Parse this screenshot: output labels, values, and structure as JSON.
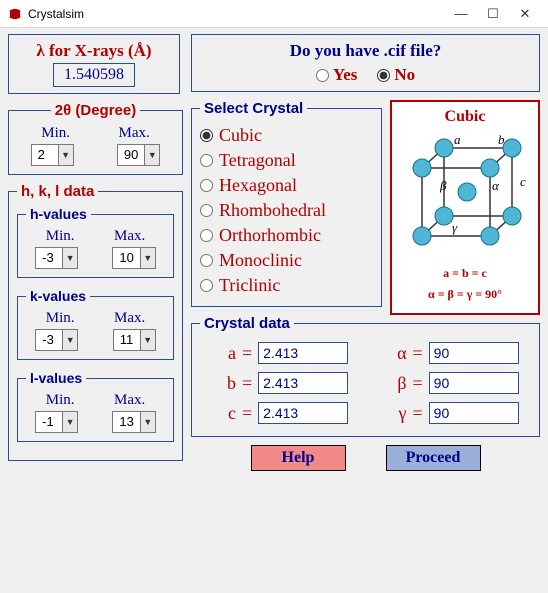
{
  "window": {
    "title": "Crystalsim"
  },
  "lambda": {
    "label": "λ for X-rays (Å)",
    "value": "1.540598"
  },
  "cif": {
    "question": "Do you have  .cif file?",
    "yes": "Yes",
    "no": "No",
    "selected": "no"
  },
  "two_theta": {
    "label": "2θ (Degree)",
    "min_label": "Min.",
    "max_label": "Max.",
    "min": "2",
    "max": "90"
  },
  "hkl": {
    "title": "h, k, l data",
    "h": {
      "label": "h-values",
      "min_label": "Min.",
      "max_label": "Max.",
      "min": "-3",
      "max": "10"
    },
    "k": {
      "label": "k-values",
      "min_label": "Min.",
      "max_label": "Max.",
      "min": "-3",
      "max": "11"
    },
    "l": {
      "label": "l-values",
      "min_label": "Min.",
      "max_label": "Max.",
      "min": "-1",
      "max": "13"
    }
  },
  "crystal": {
    "select_label": "Select Crystal",
    "options": [
      "Cubic",
      "Tetragonal",
      "Hexagonal",
      "Rhombohedral",
      "Orthorhombic",
      "Monoclinic",
      "Triclinic"
    ],
    "selected": "Cubic"
  },
  "diagram": {
    "title": "Cubic",
    "rel1": "a = b = c",
    "rel2": "α = β = γ = 90°",
    "labels": {
      "a": "a",
      "b": "b",
      "c": "c",
      "alpha": "α",
      "beta": "β",
      "gamma": "γ"
    }
  },
  "cdata": {
    "label": "Crystal data",
    "a_lbl": "a",
    "b_lbl": "b",
    "c_lbl": "c",
    "alpha_lbl": "α",
    "beta_lbl": "β",
    "gamma_lbl": "γ",
    "a": "2.413",
    "b": "2.413",
    "c": "2.413",
    "alpha": "90",
    "beta": "90",
    "gamma": "90"
  },
  "buttons": {
    "help": "Help",
    "proceed": "Proceed"
  }
}
